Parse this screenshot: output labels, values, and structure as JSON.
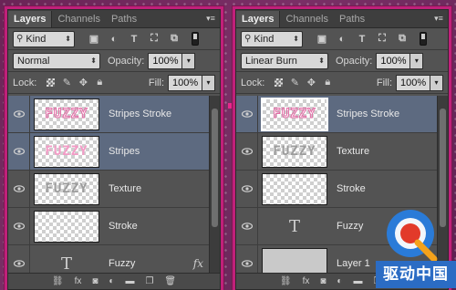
{
  "colors": {
    "accent": "#c0207a",
    "selected_row": "#5d6a80",
    "panel_bg": "#535353"
  },
  "panels": [
    {
      "tabs": [
        "Layers",
        "Channels",
        "Paths"
      ],
      "filter": {
        "kind": "Kind"
      },
      "blend_mode": "Normal",
      "opacity_label": "Opacity:",
      "opacity": "100%",
      "lock_label": "Lock:",
      "fill_label": "Fill:",
      "fill": "100%",
      "layers": [
        {
          "name": "Stripes Stroke",
          "selected": true,
          "thumb": "fuzzy-stroke"
        },
        {
          "name": "Stripes",
          "selected": true,
          "thumb": "fuzzy-pink"
        },
        {
          "name": "Texture",
          "selected": false,
          "thumb": "fuzzy-texture"
        },
        {
          "name": "Stroke",
          "selected": false,
          "thumb": "empty"
        },
        {
          "name": "Fuzzy",
          "selected": false,
          "thumb": "type",
          "fx": "fx"
        }
      ]
    },
    {
      "tabs": [
        "Layers",
        "Channels",
        "Paths"
      ],
      "filter": {
        "kind": "Kind"
      },
      "blend_mode": "Linear Burn",
      "opacity_label": "Opacity:",
      "opacity": "100%",
      "lock_label": "Lock:",
      "fill_label": "Fill:",
      "fill": "100%",
      "layers": [
        {
          "name": "Stripes Stroke",
          "selected": true,
          "thumb": "fuzzy-stroke"
        },
        {
          "name": "Texture",
          "selected": false,
          "thumb": "fuzzy-texture"
        },
        {
          "name": "Stroke",
          "selected": false,
          "thumb": "empty"
        },
        {
          "name": "Fuzzy",
          "selected": false,
          "thumb": "type"
        },
        {
          "name": "Layer 1",
          "selected": false,
          "thumb": "grey"
        }
      ]
    }
  ],
  "thumb_text": "FUZZY",
  "type_glyph": "T",
  "watermark": {
    "text": "驱动中国"
  }
}
